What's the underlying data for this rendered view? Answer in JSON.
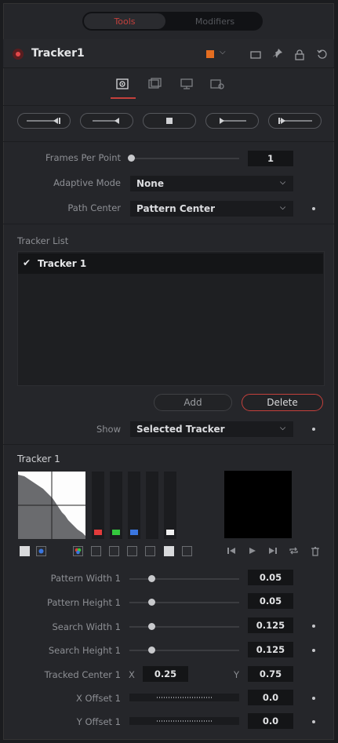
{
  "tabs": {
    "tools": "Tools",
    "modifiers": "Modifiers"
  },
  "header": {
    "title": "Tracker1",
    "color_accent": "#e46d20"
  },
  "page_icons": [
    "tracker-page-icon",
    "operation-page-icon",
    "display-page-icon",
    "settings-page-icon"
  ],
  "transport": [
    "track-reverse-from-end",
    "track-reverse",
    "stop-tracking",
    "track-forward",
    "track-forward-from-start"
  ],
  "frames_per_point": {
    "label": "Frames Per Point",
    "value": "1"
  },
  "adaptive_mode": {
    "label": "Adaptive Mode",
    "value": "None"
  },
  "path_center": {
    "label": "Path Center",
    "value": "Pattern Center"
  },
  "tracker_list": {
    "label": "Tracker List",
    "items": [
      {
        "name": "Tracker 1",
        "checked": "✔"
      }
    ]
  },
  "buttons": {
    "add": "Add",
    "delete": "Delete"
  },
  "show": {
    "label": "Show",
    "value": "Selected Tracker"
  },
  "tracker": {
    "section": "Tracker 1",
    "pattern_width": {
      "label": "Pattern Width 1",
      "value": "0.05",
      "fraction": 0.2
    },
    "pattern_height": {
      "label": "Pattern Height 1",
      "value": "0.05",
      "fraction": 0.2
    },
    "search_width": {
      "label": "Search Width 1",
      "value": "0.125",
      "fraction": 0.2
    },
    "search_height": {
      "label": "Search Height 1",
      "value": "0.125",
      "fraction": 0.2
    },
    "tracked_center": {
      "label": "Tracked Center 1",
      "x_label": "X",
      "x": "0.25",
      "y_label": "Y",
      "y": "0.75"
    },
    "x_offset": {
      "label": "X Offset 1",
      "value": "0.0"
    },
    "y_offset": {
      "label": "Y Offset 1",
      "value": "0.0"
    }
  }
}
